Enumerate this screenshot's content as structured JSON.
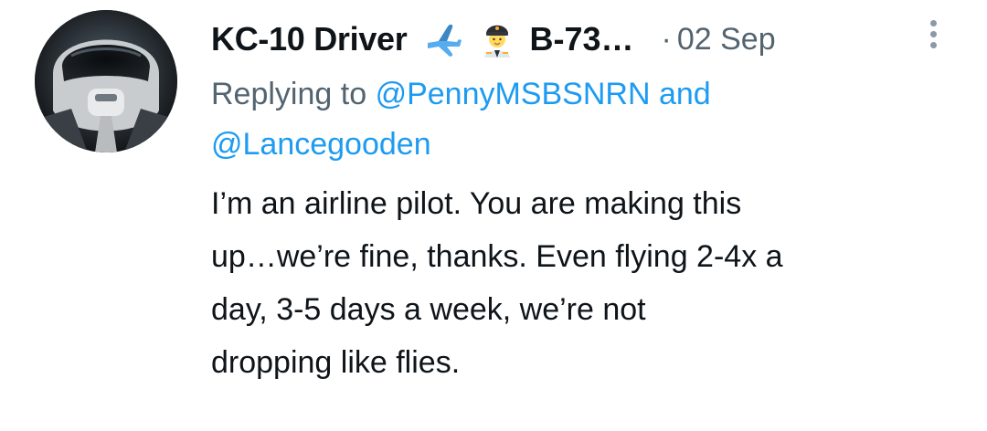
{
  "tweet": {
    "author": {
      "display_name": "KC-10 Driver",
      "emojis": [
        "airplane-emoji",
        "pilot-emoji"
      ],
      "handle_truncated": "B-73…"
    },
    "separator": "·",
    "timestamp": "02 Sep",
    "more_icon": "more-vertical-icon",
    "replying": {
      "prefix": "Replying to",
      "mention_1": "@PennyMSBSNRN",
      "joiner": "and",
      "mention_2": "@Lancegooden"
    },
    "text_lines": [
      "I’m an airline pilot. You are making this",
      "up…we’re fine, thanks. Even flying 2-4x a",
      "day, 3-5 days a week, we’re not",
      "dropping like flies."
    ]
  },
  "colors": {
    "primary_text": "#0f1419",
    "secondary_text": "#536471",
    "accent_link": "#1d9bf0"
  }
}
